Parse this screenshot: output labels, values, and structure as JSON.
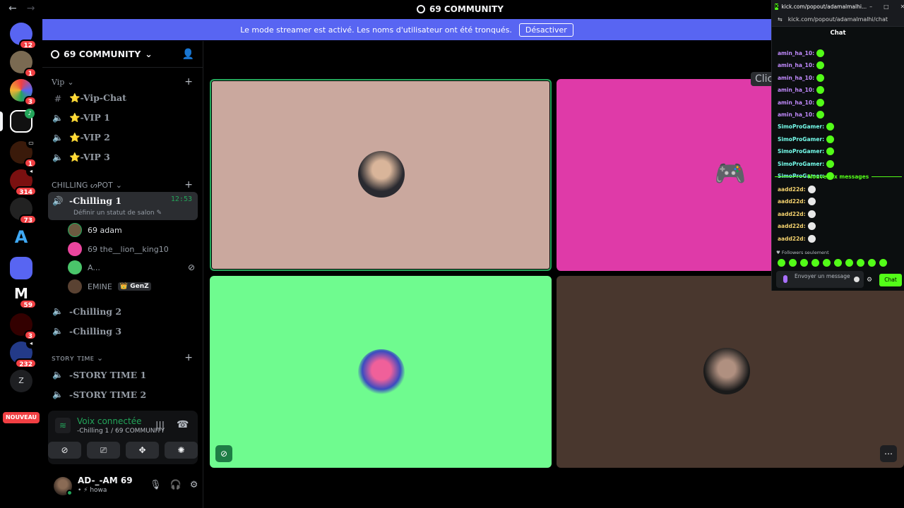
{
  "window": {
    "title": "69 COMMUNITY",
    "back": "←",
    "forward": "→"
  },
  "banner": {
    "text": "Le mode streamer est activé. Les noms d'utilisateur ont été tronqués.",
    "button": "Désactiver"
  },
  "rail": {
    "badges": [
      "12",
      "1",
      "3",
      "1",
      "314",
      "73",
      "59",
      "3",
      "232"
    ],
    "letters": [
      "Z"
    ],
    "nouveau": "NOUVEAU"
  },
  "guild": {
    "name": "69 COMMUNITY"
  },
  "categories": [
    {
      "name": "Vip"
    },
    {
      "name": "CHILLING ᔕPOT"
    },
    {
      "name": "ꜱᴛᴏʀʏ ᴛɪᴍᴇ"
    }
  ],
  "channels": {
    "vip_chat": "⭐-Vip-Chat",
    "vip1": "⭐-VIP 1",
    "vip2": "⭐-VIP 2",
    "vip3": "⭐-VIP 3",
    "chilling1": "-Chilling 1",
    "chilling1_time": "12:53",
    "chilling1_status": "Définir un statut de salon",
    "chilling2": "-Chilling 2",
    "chilling3": "-Chilling 3",
    "story1": "-STORY TIME 1",
    "story2": "-STORY TIME 2"
  },
  "members": [
    {
      "name": "69 adam",
      "tag": ""
    },
    {
      "name": "69 the__lion__king10",
      "tag": ""
    },
    {
      "name": "A...",
      "tag": ""
    },
    {
      "name": "EMINE",
      "tag": "GenZ"
    }
  ],
  "voice": {
    "title": "Voix connectée",
    "sub": "-Chilling 1 / 69 COMMUNITY"
  },
  "user": {
    "name": "AD-_-AM 69",
    "status": "• ⚡ howa"
  },
  "stage": {
    "clic": "Clic"
  },
  "kick": {
    "tab_title": "kick.com/popout/adamalmalhi...",
    "url": "kick.com/popout/adamalmalhi/chat",
    "header": "Chat",
    "messages": [
      {
        "user": "amin_ha_10:",
        "color": "#c28bff"
      },
      {
        "user": "amin_ha_10:",
        "color": "#c28bff"
      },
      {
        "user": "amin_ha_10:",
        "color": "#c28bff"
      },
      {
        "user": "amin_ha_10:",
        "color": "#c28bff"
      },
      {
        "user": "amin_ha_10:",
        "color": "#c28bff"
      },
      {
        "user": "amin_ha_10:",
        "color": "#c28bff"
      },
      {
        "user": "SimoProGamer:",
        "color": "#75fdeb"
      },
      {
        "user": "SimoProGamer:",
        "color": "#75fdeb"
      },
      {
        "user": "SimoProGamer:",
        "color": "#75fdeb"
      },
      {
        "user": "SimoProGamer:",
        "color": "#75fdeb"
      },
      {
        "user": "SimoProGamer:",
        "color": "#75fdeb"
      }
    ],
    "divider": "Nouveaux messages",
    "new_messages": [
      {
        "user": "aadd22d:",
        "color": "#f4d26e"
      },
      {
        "user": "aadd22d:",
        "color": "#f4d26e"
      },
      {
        "user": "aadd22d:",
        "color": "#f4d26e"
      },
      {
        "user": "aadd22d:",
        "color": "#f4d26e"
      },
      {
        "user": "aadd22d:",
        "color": "#f4d26e"
      }
    ],
    "followers": "♥ Followers seulement",
    "input_placeholder": "Envoyer un message",
    "chat_button": "Chat"
  },
  "colors": {
    "blurple": "#5865f2",
    "green": "#23a55a",
    "kick_green": "#53fc18",
    "red": "#f23f43"
  }
}
